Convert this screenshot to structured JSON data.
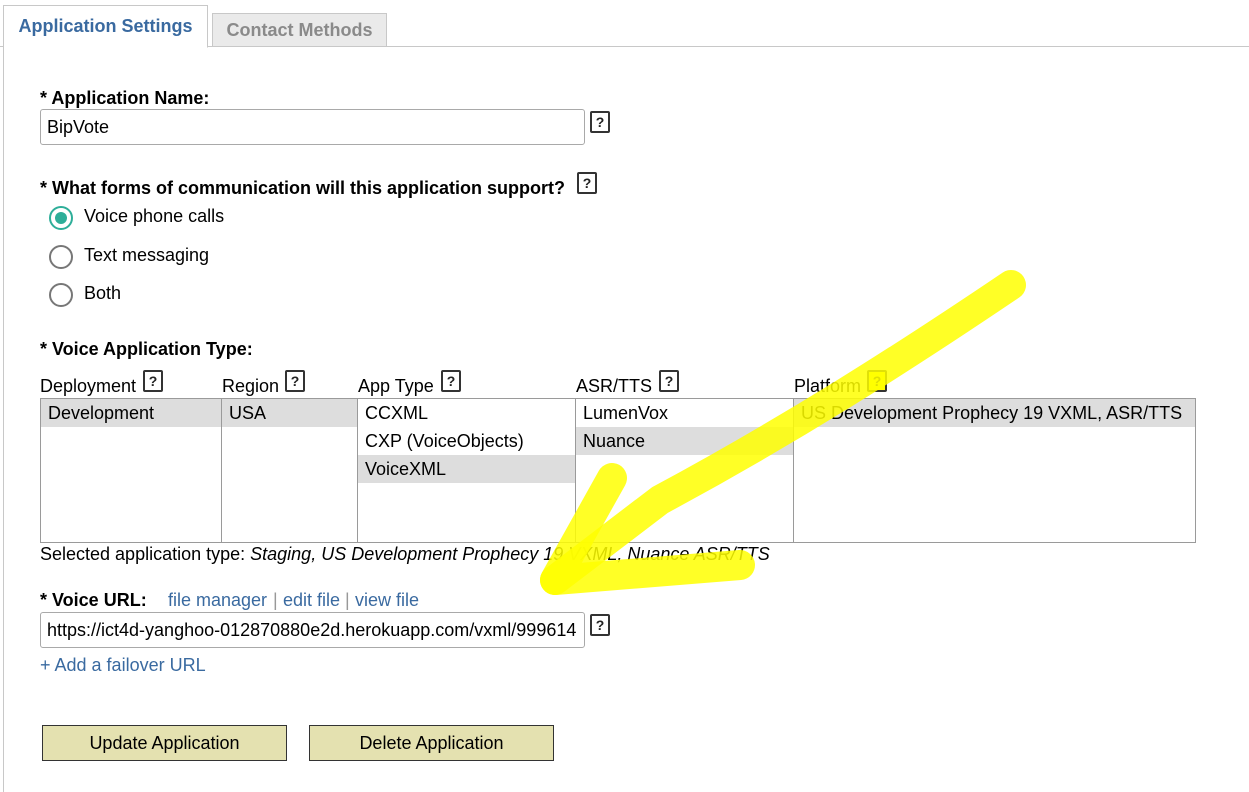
{
  "tabs": [
    {
      "label": "Application Settings",
      "active": true
    },
    {
      "label": "Contact Methods",
      "active": false
    }
  ],
  "app_name": {
    "label": "* Application Name:",
    "value": "BipVote"
  },
  "communication": {
    "label": "* What forms of communication will this application support?",
    "options": [
      {
        "label": "Voice phone calls",
        "checked": true
      },
      {
        "label": "Text messaging",
        "checked": false
      },
      {
        "label": "Both",
        "checked": false
      }
    ]
  },
  "voice_type": {
    "label": "* Voice Application Type:",
    "columns": [
      {
        "header": "Deployment",
        "options": [
          "Development"
        ],
        "selected": 0
      },
      {
        "header": "Region",
        "options": [
          "USA"
        ],
        "selected": 0
      },
      {
        "header": "App Type",
        "options": [
          "CCXML",
          "CXP (VoiceObjects)",
          "VoiceXML"
        ],
        "selected": 2
      },
      {
        "header": "ASR/TTS",
        "options": [
          "LumenVox",
          "Nuance"
        ],
        "selected": 1
      },
      {
        "header": "Platform",
        "options": [
          "US Development Prophecy 19 VXML, ASR/TTS"
        ],
        "selected": 0
      }
    ],
    "selected_prefix": "Selected application type: ",
    "selected_value": "Staging, US Development Prophecy 19 VXML, Nuance ASR/TTS"
  },
  "voice_url": {
    "label": "* Voice URL:",
    "links": [
      "file manager",
      "edit file",
      "view file"
    ],
    "separator": "|",
    "value": "https://ict4d-yanghoo-012870880e2d.herokuapp.com/vxml/999614",
    "failover": "+ Add a failover URL"
  },
  "help_glyph": "?",
  "buttons": {
    "update": "Update Application",
    "delete": "Delete Application"
  },
  "colors": {
    "link": "#3a6aa0",
    "radio_checked": "#2eae99",
    "button_bg": "#e4e1b0",
    "highlight": "#ffff00",
    "selected_row": "#dddddd"
  }
}
